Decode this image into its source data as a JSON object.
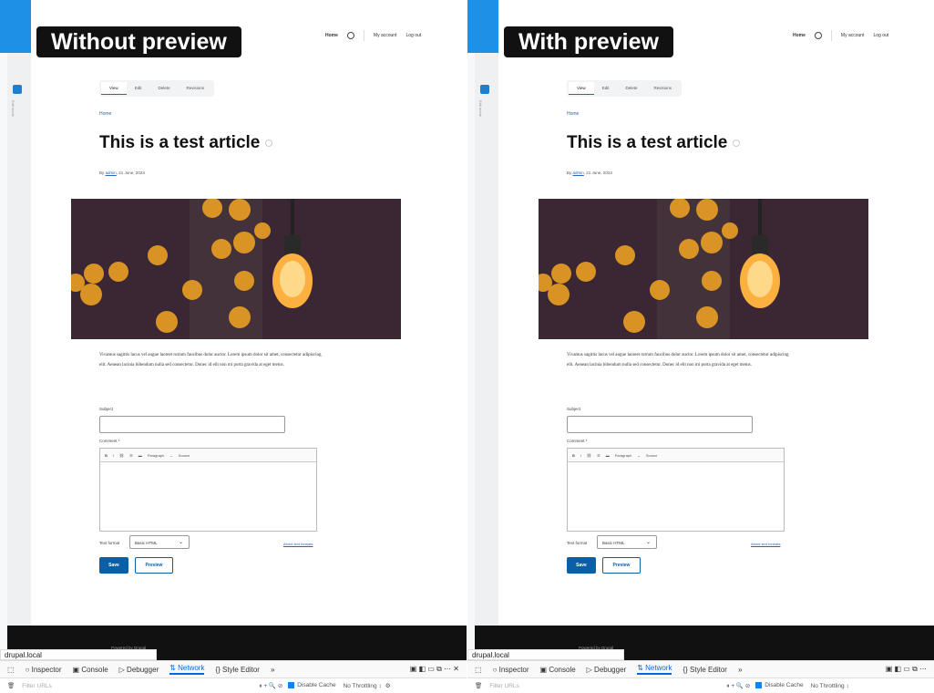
{
  "panels": [
    {
      "caption": "Without preview",
      "nav": {
        "home": "Home",
        "account": "My account",
        "logout": "Log out"
      },
      "toolbar_label": "Edit mode",
      "tabs": [
        "View",
        "Edit",
        "Delete",
        "Revisions"
      ],
      "breadcrumb": "Home",
      "title": "This is a test article",
      "byline": {
        "prefix": "By",
        "author": "admin",
        "date": ", 21 June, 2023"
      },
      "body": "Vivamus sagittis lacus vel augue laoreet rutrum faucibus dolor auctor. Lorem ipsum dolor sit amet, consectetur adipiscing elit. Aenean lacinia bibendum nulla sed consectetur. Donec id elit non mi porta gravida at eget metus.",
      "subject_label": "Subject",
      "comment_label": "Comment *",
      "editor_toolbar": {
        "paragraph": "Paragraph",
        "source": "Source"
      },
      "text_format_label": "Text format",
      "text_format_value": "Basic HTML",
      "format_help_link": "About text formats",
      "save": "Save",
      "preview": "Preview",
      "footer": "Powered by Drupal",
      "url": "drupal.local"
    },
    {
      "caption": "With preview",
      "nav": {
        "home": "Home",
        "account": "My account",
        "logout": "Log out"
      },
      "toolbar_label": "Edit mode",
      "tabs": [
        "View",
        "Edit",
        "Delete",
        "Revisions"
      ],
      "breadcrumb": "Home",
      "title": "This is a test article",
      "byline": {
        "prefix": "By",
        "author": "admin",
        "date": ", 21 June, 2023"
      },
      "body": "Vivamus sagittis lacus vel augue laoreet rutrum faucibus dolor auctor. Lorem ipsum dolor sit amet, consectetur adipiscing elit. Aenean lacinia bibendum nulla sed consectetur. Donec id elit non mi porta gravida at eget metus.",
      "subject_label": "Subject",
      "comment_label": "Comment *",
      "editor_toolbar": {
        "paragraph": "Paragraph",
        "source": "Source"
      },
      "text_format_label": "Text format",
      "text_format_value": "Basic HTML",
      "format_help_link": "About text formats",
      "save": "Save",
      "preview": "Preview",
      "footer": "Powered by Drupal",
      "url": "drupal.local"
    }
  ],
  "devtools": {
    "tabs": [
      "Inspector",
      "Console",
      "Debugger",
      "Network",
      "Style Editor"
    ],
    "active_tab": "Network",
    "filter_placeholder": "Filter URLs",
    "disable_cache": "Disable Cache",
    "throttling": "No Throttling ↕"
  },
  "colors": {
    "accent": "#1e90e6",
    "drupal_blue": "#0b5ea8",
    "devtools_active": "#0a66d8"
  }
}
